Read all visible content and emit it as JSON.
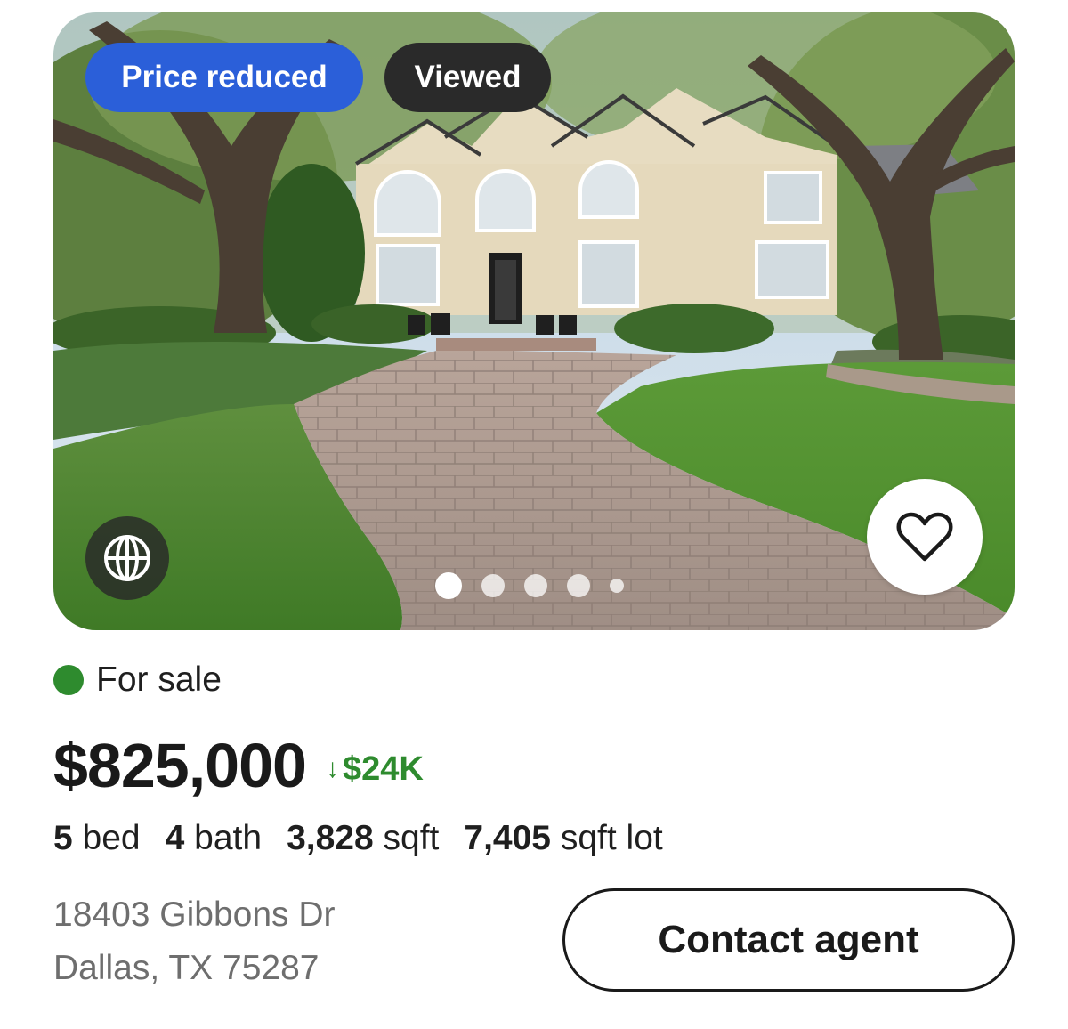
{
  "listing": {
    "badges": {
      "price_reduced": "Price reduced",
      "viewed": "Viewed"
    },
    "photo": {
      "alt": "Two-story beige stucco house with arched windows, large oak trees and a curved paver walkway",
      "current_index": 1,
      "total_dots": 5
    },
    "icons": {
      "globe": "globe-icon",
      "heart": "heart-outline-icon"
    },
    "status": {
      "label": "For sale",
      "color": "#2e8b2e"
    },
    "price": {
      "value": "$825,000",
      "change": "$24K",
      "change_direction": "down",
      "change_color": "#2e8b2e"
    },
    "facts": [
      {
        "value": "5",
        "unit": "bed"
      },
      {
        "value": "4",
        "unit": "bath"
      },
      {
        "value": "3,828",
        "unit": "sqft"
      },
      {
        "value": "7,405",
        "unit": "sqft lot"
      }
    ],
    "address": {
      "line1": "18403 Gibbons Dr",
      "line2": "Dallas, TX 75287"
    },
    "contact_button": "Contact agent",
    "colors": {
      "badge_blue": "#2b5fd9",
      "badge_dark": "#2a2a2a"
    }
  }
}
